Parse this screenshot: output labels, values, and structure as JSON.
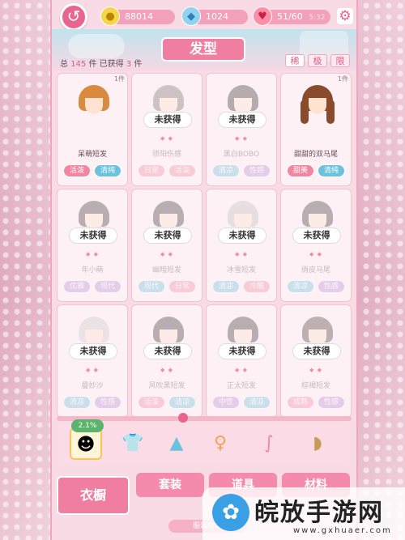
{
  "topbar": {
    "gold": "88014",
    "gems": "1024",
    "energy": "51/60",
    "energy_timer": "5:32"
  },
  "header": {
    "title": "发型",
    "count_prefix": "总",
    "total": "145",
    "unit": "件",
    "obtained_label": "已获得",
    "obtained": "3",
    "filters": [
      "稀",
      "极",
      "限"
    ]
  },
  "grid": {
    "unobtained_label": "未获得",
    "items": [
      {
        "name": "呆萌短发",
        "pcs": "1件",
        "locked": false,
        "color": "#d98a3e",
        "tags": [
          {
            "label": "活泼",
            "color": "#f2859f"
          },
          {
            "label": "清纯",
            "color": "#6ac2de"
          }
        ]
      },
      {
        "name": "骄阳伤感",
        "pcs": "",
        "locked": true,
        "color": "#7a6a66",
        "tags": [
          {
            "label": "日常",
            "color": "#f2859f"
          },
          {
            "label": "活泼",
            "color": "#f2859f"
          }
        ]
      },
      {
        "name": "黑白BOBO",
        "pcs": "",
        "locked": true,
        "color": "#2c2c2c",
        "tags": [
          {
            "label": "清凉",
            "color": "#6ac2de"
          },
          {
            "label": "性感",
            "color": "#b98bd6"
          }
        ]
      },
      {
        "name": "甜甜的双马尾",
        "pcs": "1件",
        "locked": false,
        "color": "#8a4a2c",
        "tags": [
          {
            "label": "甜美",
            "color": "#f2859f"
          },
          {
            "label": "清纯",
            "color": "#6ac2de"
          }
        ]
      },
      {
        "name": "年小萌",
        "pcs": "",
        "locked": true,
        "color": "#3a3434",
        "tags": [
          {
            "label": "优雅",
            "color": "#b98bd6"
          },
          {
            "label": "现代",
            "color": "#b98bd6"
          }
        ]
      },
      {
        "name": "幽暗短发",
        "pcs": "",
        "locked": true,
        "color": "#3a3434",
        "tags": [
          {
            "label": "现代",
            "color": "#6ac2de"
          },
          {
            "label": "日常",
            "color": "#f2859f"
          }
        ]
      },
      {
        "name": "冰雪短发",
        "pcs": "",
        "locked": true,
        "color": "#bdbdbd",
        "tags": [
          {
            "label": "清凉",
            "color": "#6ac2de"
          },
          {
            "label": "冷酷",
            "color": "#f2859f"
          }
        ]
      },
      {
        "name": "俏皮马尾",
        "pcs": "",
        "locked": true,
        "color": "#3a3434",
        "tags": [
          {
            "label": "清凉",
            "color": "#6ac2de"
          },
          {
            "label": "性感",
            "color": "#b98bd6"
          }
        ]
      },
      {
        "name": "曼妙沙",
        "pcs": "",
        "locked": true,
        "color": "#c8c8c8",
        "tags": [
          {
            "label": "清凉",
            "color": "#6ac2de"
          },
          {
            "label": "性感",
            "color": "#b98bd6"
          }
        ]
      },
      {
        "name": "风吹黑短发",
        "pcs": "",
        "locked": true,
        "color": "#3a3434",
        "tags": [
          {
            "label": "活泼",
            "color": "#f2859f"
          },
          {
            "label": "清凉",
            "color": "#6ac2de"
          }
        ]
      },
      {
        "name": "正太短发",
        "pcs": "",
        "locked": true,
        "color": "#3a3434",
        "tags": [
          {
            "label": "中性",
            "color": "#b98bd6"
          },
          {
            "label": "清凉",
            "color": "#6ac2de"
          }
        ]
      },
      {
        "name": "棕褐短发",
        "pcs": "",
        "locked": true,
        "color": "#4a3a34",
        "tags": [
          {
            "label": "成熟",
            "color": "#f2859f"
          },
          {
            "label": "性感",
            "color": "#b98bd6"
          }
        ]
      }
    ]
  },
  "category_bar": {
    "percent": "2.1%",
    "icons": [
      "hair-icon",
      "top-icon",
      "skirt-icon",
      "dress-icon",
      "socks-icon",
      "shoes-icon"
    ]
  },
  "bottom_tabs": {
    "wardrobe": "衣橱",
    "suit": "套装",
    "props": "道具",
    "material": "材料",
    "collection": "服装收集"
  },
  "watermark": {
    "text": "皖放手游网",
    "url": "www.gxhuaer.com"
  }
}
